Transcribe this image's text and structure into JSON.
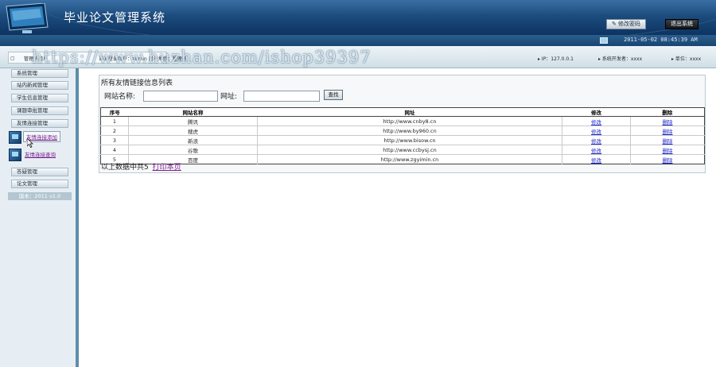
{
  "header": {
    "title": "毕业论文管理系统",
    "change_password_label": "修改密码",
    "logout_label": "退出系统"
  },
  "clockbar": {
    "datetime": "2011-05-02 08:45:39 AM"
  },
  "infobar": {
    "admin_tab": "管理员用户",
    "current_user_label": "当前登录用户：admin 用户角色：管理员",
    "ip_label": "▸ IP：127.0.0.1",
    "developer_label": "▸ 系统开发者：xxxx",
    "unit_label": "▸ 单位：xxxx"
  },
  "watermark": {
    "text": "https://www.huzhan.com/ishop39397"
  },
  "sidebar": {
    "menu": [
      {
        "label": "系统管理"
      },
      {
        "label": "站内新闻管理"
      },
      {
        "label": "学生信息管理"
      },
      {
        "label": "课题审批管理"
      },
      {
        "label": "友情连接管理"
      }
    ],
    "sub_items": [
      {
        "label": "友情连接添加"
      },
      {
        "label": "友情连接查询"
      }
    ],
    "menu_bottom": [
      {
        "label": "答疑管理"
      },
      {
        "label": "论文管理"
      }
    ],
    "version": "版本：2011 v1.0"
  },
  "main": {
    "panel_title": "所有友情链接信息列表",
    "search": {
      "name_label": "网站名称:",
      "url_label": "网址:",
      "name_value": "",
      "url_value": "",
      "button_label": "查找"
    },
    "table": {
      "headers": [
        "序号",
        "网站名称",
        "网址",
        "修改",
        "删除"
      ],
      "rows": [
        {
          "no": "1",
          "name": "腾讯",
          "url": "http://www.cnby8.cn",
          "edit": "修改",
          "del": "删除"
        },
        {
          "no": "2",
          "name": "搜虎",
          "url": "http://www.by960.cn",
          "edit": "修改",
          "del": "删除"
        },
        {
          "no": "3",
          "name": "新浪",
          "url": "http://www.bisow.cn",
          "edit": "修改",
          "del": "删除"
        },
        {
          "no": "4",
          "name": "谷歌",
          "url": "http://www.ccbysj.cn",
          "edit": "修改",
          "del": "删除"
        },
        {
          "no": "5",
          "name": "百度",
          "url": "http://www.zgyimin.cn",
          "edit": "修改",
          "del": "删除"
        }
      ]
    },
    "total_text": "以上数据中共5",
    "print_label": "打印本页"
  }
}
